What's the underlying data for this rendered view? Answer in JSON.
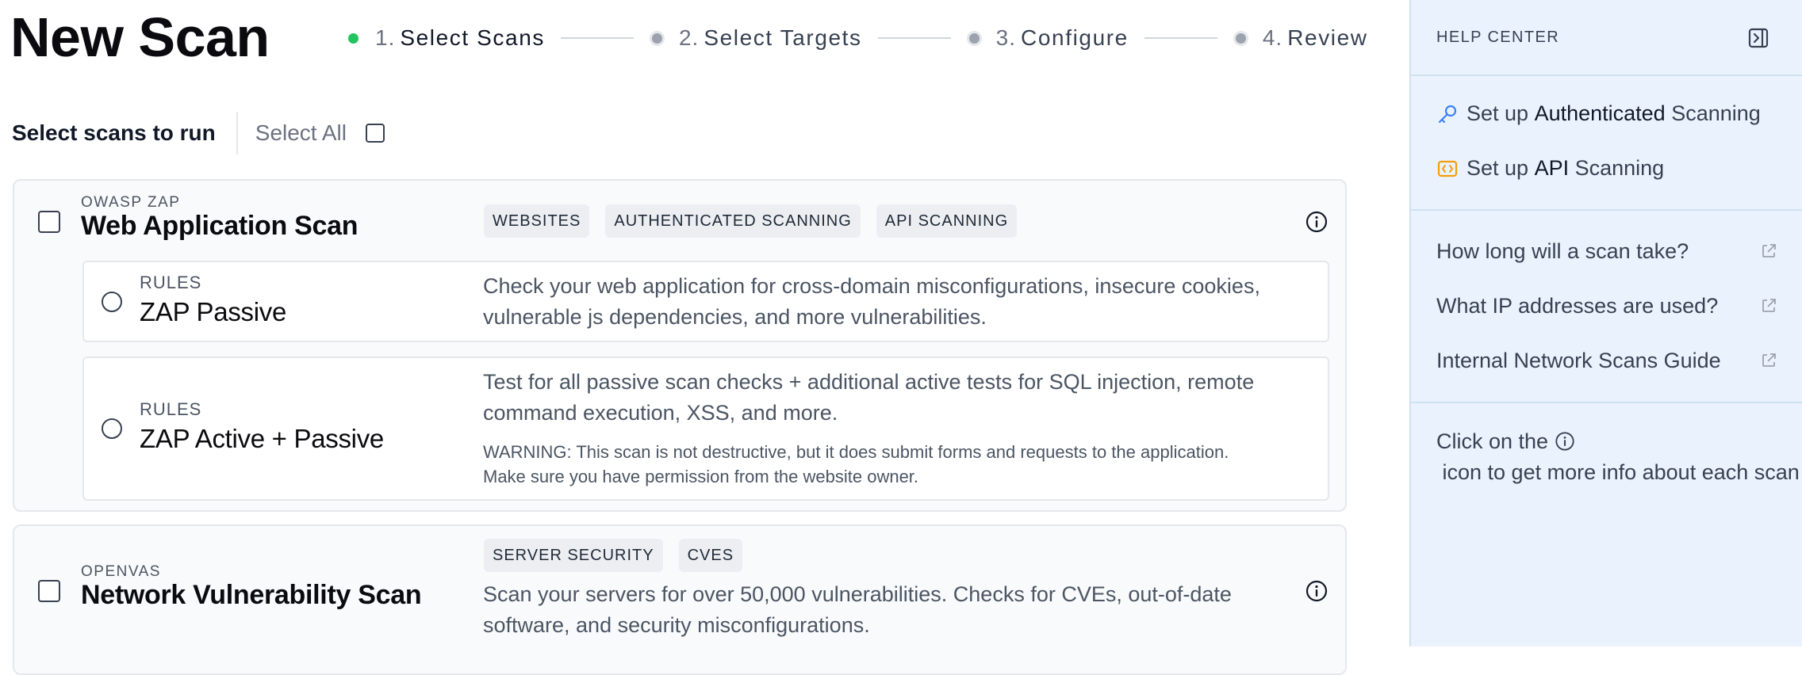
{
  "page": {
    "title": "New Scan"
  },
  "stepper": {
    "steps": [
      {
        "num": "1.",
        "label": "Select Scans",
        "state": "active"
      },
      {
        "num": "2.",
        "label": "Select Targets",
        "state": "pending"
      },
      {
        "num": "3.",
        "label": "Configure",
        "state": "pending"
      },
      {
        "num": "4.",
        "label": "Review",
        "state": "pending"
      }
    ]
  },
  "selection": {
    "title": "Select scans to run",
    "select_all_label": "Select All",
    "select_all_checked": false
  },
  "scans": [
    {
      "vendor": "OWASP ZAP",
      "title": "Web Application Scan",
      "checked": false,
      "tags": [
        "WEBSITES",
        "AUTHENTICATED SCANNING",
        "API SCANNING"
      ],
      "rules": [
        {
          "kicker": "RULES",
          "title": "ZAP Passive",
          "description": "Check your web application for cross-domain misconfigurations, insecure cookies, vulnerable js dependencies, and more vulnerabilities.",
          "selected": false
        },
        {
          "kicker": "RULES",
          "title": "ZAP Active + Passive",
          "description": "Test for all passive scan checks + additional active tests for SQL injection, remote command execution, XSS, and more.",
          "warning": "WARNING: This scan is not destructive, but it does submit forms and requests to the application. Make sure you have permission from the website owner.",
          "selected": false
        }
      ]
    },
    {
      "vendor": "OPENVAS",
      "title": "Network Vulnerability Scan",
      "checked": false,
      "tags": [
        "SERVER SECURITY",
        "CVES"
      ],
      "description": "Scan your servers for over 50,000 vulnerabilities. Checks for CVEs, out-of-date software, and security misconfigurations."
    }
  ],
  "help": {
    "title": "HELP CENTER",
    "guides": [
      {
        "prefix": "Set up ",
        "strong": "Authenticated",
        "suffix": " Scanning",
        "icon": "key-icon"
      },
      {
        "prefix": "Set up ",
        "strong": "API",
        "suffix": " Scanning",
        "icon": "code-icon"
      }
    ],
    "faqs": [
      "How long will a scan take?",
      "What IP addresses are used?",
      "Internal Network Scans Guide"
    ],
    "tip_before": "Click on the ",
    "tip_after": " icon to get more info about each scan"
  },
  "colors": {
    "accent_active_step": "#22c55e",
    "help_panel_bg": "#eaf3fd",
    "key_icon": "#3b82f6",
    "code_icon": "#f59e0b"
  }
}
